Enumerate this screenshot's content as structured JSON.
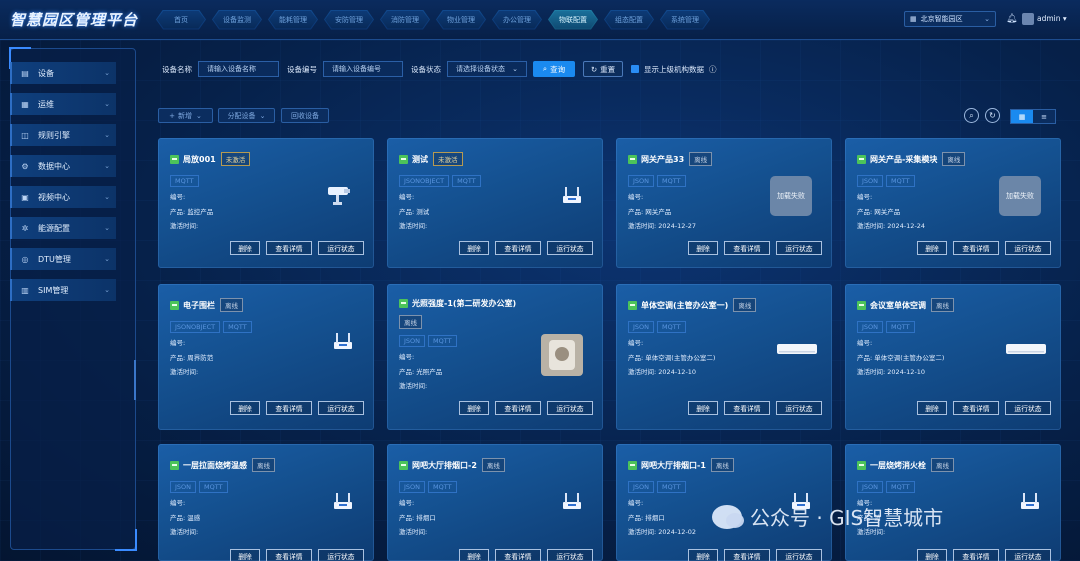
{
  "brand": "智慧园区管理平台",
  "nav": [
    "首页",
    "设备监测",
    "能耗管理",
    "安防管理",
    "消防管理",
    "物业管理",
    "办公管理",
    "物联配置",
    "组态配置",
    "系统管理"
  ],
  "nav_active_index": 7,
  "header": {
    "park": "北京智能园区",
    "user": "admin"
  },
  "sidebar": [
    {
      "label": "设备",
      "icon": "device-icon"
    },
    {
      "label": "运维",
      "icon": "maintenance-icon"
    },
    {
      "label": "规则引擎",
      "icon": "rule-icon"
    },
    {
      "label": "数据中心",
      "icon": "data-icon"
    },
    {
      "label": "视频中心",
      "icon": "video-icon"
    },
    {
      "label": "能源配置",
      "icon": "energy-icon"
    },
    {
      "label": "DTU管理",
      "icon": "dtu-icon"
    },
    {
      "label": "SIM管理",
      "icon": "sim-icon"
    }
  ],
  "filter": {
    "name_label": "设备名称",
    "name_placeholder": "请输入设备名称",
    "code_label": "设备编号",
    "code_placeholder": "请输入设备编号",
    "status_label": "设备状态",
    "status_placeholder": "请选择设备状态",
    "query": "查询",
    "reset": "重置",
    "show_parent": "显示上级机构数据"
  },
  "actions": {
    "add": "新增",
    "assign": "分配设备",
    "recycle": "回收设备"
  },
  "card_labels": {
    "code": "编号:",
    "product": "产品:",
    "activate": "激活时间:",
    "delete": "删除",
    "detail": "查看详情",
    "status": "运行状态"
  },
  "devices": [
    {
      "name": "局放001",
      "badge": "未激活",
      "tags": [
        "MQTT"
      ],
      "product": "监控产品",
      "date": "",
      "image": "camera"
    },
    {
      "name": "测试",
      "badge": "未激活",
      "tags": [
        "JSONOBJECT",
        "MQTT"
      ],
      "product": "测试",
      "date": "",
      "image": "router"
    },
    {
      "name": "网关产品33",
      "badge": "离线",
      "tags": [
        "JSON",
        "MQTT"
      ],
      "product": "网关产品",
      "date": "2024-12-27",
      "image": "fail",
      "fail_text": "加载失败"
    },
    {
      "name": "网关产品-采集模块",
      "badge": "离线",
      "tags": [
        "JSON",
        "MQTT"
      ],
      "product": "网关产品",
      "date": "2024-12-24",
      "image": "fail",
      "fail_text": "加载失败"
    },
    {
      "name": "电子围栏",
      "badge": "离线",
      "tags": [
        "JSONOBJECT",
        "MQTT"
      ],
      "product": "周界防范",
      "date": "",
      "image": "router"
    },
    {
      "name": "光照强度-1(第二研发办公室)",
      "badge": "离线",
      "tags": [
        "JSON",
        "MQTT"
      ],
      "product": "光照产品",
      "date": "",
      "image": "photo"
    },
    {
      "name": "单体空调(主管办公室一)",
      "badge": "离线",
      "tags": [
        "JSON",
        "MQTT"
      ],
      "product": "单体空调(主管办公室二)",
      "date": "2024-12-10",
      "image": "ac"
    },
    {
      "name": "会议室单体空调",
      "badge": "离线",
      "tags": [
        "JSON",
        "MQTT"
      ],
      "product": "单体空调(主管办公室二)",
      "date": "2024-12-10",
      "image": "ac"
    },
    {
      "name": "一层拉面烧烤温感",
      "badge": "离线",
      "tags": [
        "JSON",
        "MQTT"
      ],
      "product": "温感",
      "date": "",
      "image": "router"
    },
    {
      "name": "网吧大厅排烟口-2",
      "badge": "离线",
      "tags": [
        "JSON",
        "MQTT"
      ],
      "product": "排烟口",
      "date": "",
      "image": "router"
    },
    {
      "name": "网吧大厅排烟口-1",
      "badge": "离线",
      "tags": [
        "JSON",
        "MQTT"
      ],
      "product": "排烟口",
      "date": "2024-12-02",
      "image": "router"
    },
    {
      "name": "一层烧烤消火栓",
      "badge": "离线",
      "tags": [
        "JSON",
        "MQTT"
      ],
      "product": "消",
      "date": "",
      "image": "router"
    }
  ],
  "watermark": "公众号 · GIS智慧城市",
  "colors": {
    "accent": "#1a8af0",
    "card": "#14508f",
    "online_icon": "#4cc35a"
  }
}
